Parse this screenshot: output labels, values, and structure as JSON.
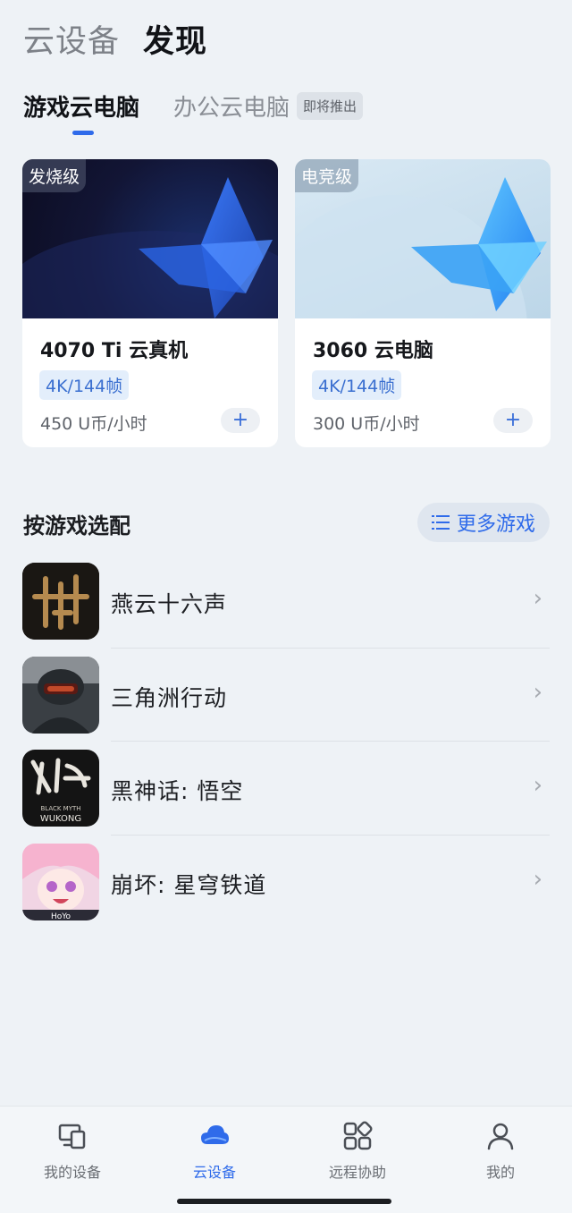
{
  "top_tabs": [
    "云设备",
    "发现"
  ],
  "sub_tabs": {
    "gaming": "游戏云电脑",
    "office": "办公云电脑",
    "office_badge": "即将推出"
  },
  "cards": [
    {
      "tier": "发烧级",
      "title": "4070 Ti 云真机",
      "spec": "4K/144帧",
      "price": "450 U币/小时",
      "add": "+"
    },
    {
      "tier": "电竞级",
      "title": "3060 云电脑",
      "spec": "4K/144帧",
      "price": "300 U币/小时",
      "add": "+"
    }
  ],
  "section": {
    "title": "按游戏选配",
    "more_label": "更多游戏"
  },
  "games": [
    {
      "name": "燕云十六声"
    },
    {
      "name": "三角洲行动"
    },
    {
      "name": "黑神话: 悟空",
      "logo_text": "BLACK MYTH WUKONG"
    },
    {
      "name": "崩坏: 星穹铁道",
      "logo_text": "HoYo"
    }
  ],
  "bottom_nav": [
    {
      "label": "我的设备",
      "icon": "devices-icon"
    },
    {
      "label": "云设备",
      "icon": "cloud-icon",
      "active": true
    },
    {
      "label": "远程协助",
      "icon": "remote-assist-icon"
    },
    {
      "label": "我的",
      "icon": "profile-icon"
    }
  ],
  "colors": {
    "accent": "#2f6bea",
    "background": "#eef2f6"
  }
}
